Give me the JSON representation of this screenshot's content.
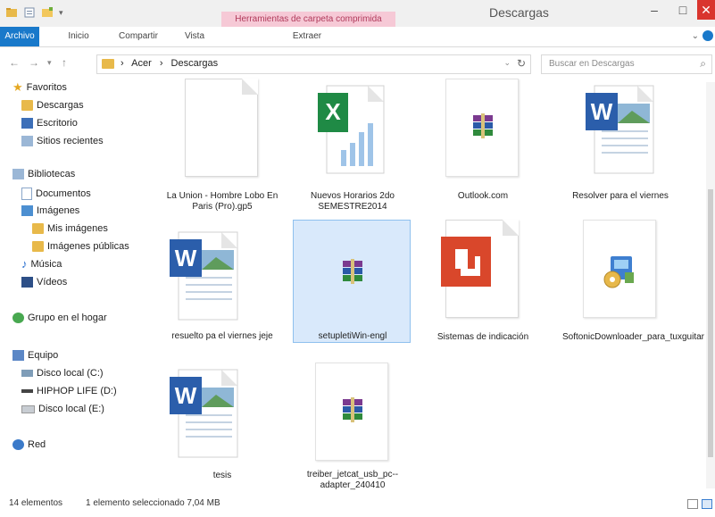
{
  "window": {
    "title": "Descargas",
    "contextual_tab": "Herramientas de carpeta comprimida",
    "minimize": "–",
    "maximize": "□",
    "close": "✕"
  },
  "ribbon": {
    "tabs": [
      "Archivo",
      "Inicio",
      "Compartir",
      "Vista",
      "Extraer"
    ],
    "collapse": "⌄"
  },
  "address": {
    "breadcrumbs": [
      "›",
      "Acer",
      "›",
      "Descargas"
    ],
    "search_placeholder": "Buscar en Descargas",
    "back": "←",
    "forward": "→",
    "recent": "▾",
    "up": "↑",
    "dropdown": "⌄",
    "refresh": "↻",
    "search_icon": "⌕"
  },
  "nav": {
    "items": [
      {
        "label": "Favoritos",
        "icon": "star-icon"
      },
      {
        "label": "Descargas",
        "icon": "download-folder-icon"
      },
      {
        "label": "Escritorio",
        "icon": "desktop-icon"
      },
      {
        "label": "Sitios recientes",
        "icon": "recent-places-icon"
      },
      {
        "label": "Bibliotecas",
        "icon": "library-icon"
      },
      {
        "label": "Documentos",
        "icon": "documents-icon"
      },
      {
        "label": "Imágenes",
        "icon": "pictures-icon"
      },
      {
        "label": "Mis imágenes",
        "icon": "folder-icon"
      },
      {
        "label": "Imágenes públicas",
        "icon": "folder-icon"
      },
      {
        "label": "Música",
        "icon": "music-icon"
      },
      {
        "label": "Vídeos",
        "icon": "videos-icon"
      },
      {
        "label": "Grupo en el hogar",
        "icon": "homegroup-icon"
      },
      {
        "label": "Equipo",
        "icon": "computer-icon"
      },
      {
        "label": "Disco local (C:)",
        "icon": "drive-icon"
      },
      {
        "label": "HIPHOP LIFE (D:)",
        "icon": "usb-drive-icon"
      },
      {
        "label": "Disco local (E:)",
        "icon": "drive-icon"
      },
      {
        "label": "Red",
        "icon": "network-icon"
      }
    ]
  },
  "files": [
    {
      "name": "La Union - Hombre Lobo En Paris (Pro).gp5",
      "type": "blank"
    },
    {
      "name": "Nuevos Horarios 2do SEMESTRE2014",
      "type": "excel"
    },
    {
      "name": "Outlook.com",
      "type": "rar"
    },
    {
      "name": "Resolver para el viernes",
      "type": "word"
    },
    {
      "name": "resuelto pa el viernes jeje",
      "type": "word"
    },
    {
      "name": "setupletiWin-engl",
      "type": "rar"
    },
    {
      "name": "Sistemas de indicación",
      "type": "pdf"
    },
    {
      "name": "SoftonicDownloader_para_tuxguitar",
      "type": "installer"
    },
    {
      "name": "tesis",
      "type": "word"
    },
    {
      "name": "treiber_jetcat_usb_pc--adapter_240410",
      "type": "rar"
    }
  ],
  "status": {
    "count": "14 elementos",
    "selection": "1 elemento seleccionado  7,04 MB"
  }
}
